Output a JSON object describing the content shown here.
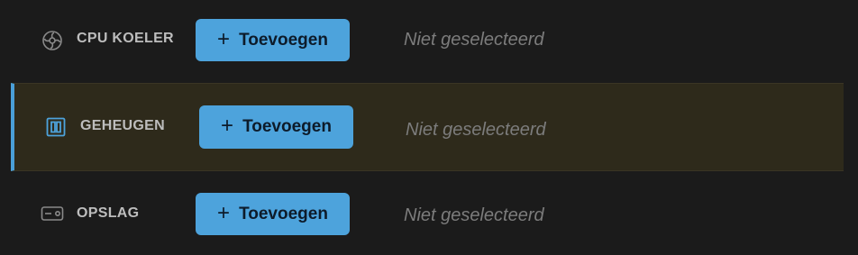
{
  "rows": [
    {
      "label": "CPU KOELER",
      "icon": "fan-icon",
      "button_label": "Toevoegen",
      "status": "Niet geselecteerd"
    },
    {
      "label": "GEHEUGEN",
      "icon": "memory-icon",
      "button_label": "Toevoegen",
      "status": "Niet geselecteerd",
      "highlighted": true
    },
    {
      "label": "OPSLAG",
      "icon": "storage-drive-icon",
      "button_label": "Toevoegen",
      "status": "Niet geselecteerd"
    }
  ],
  "colors": {
    "background": "#1b1b1b",
    "highlight_row": "#2e2a1b",
    "accent": "#4da3dc",
    "label_text": "#bdbdbd",
    "status_text": "#7c7c7c"
  }
}
